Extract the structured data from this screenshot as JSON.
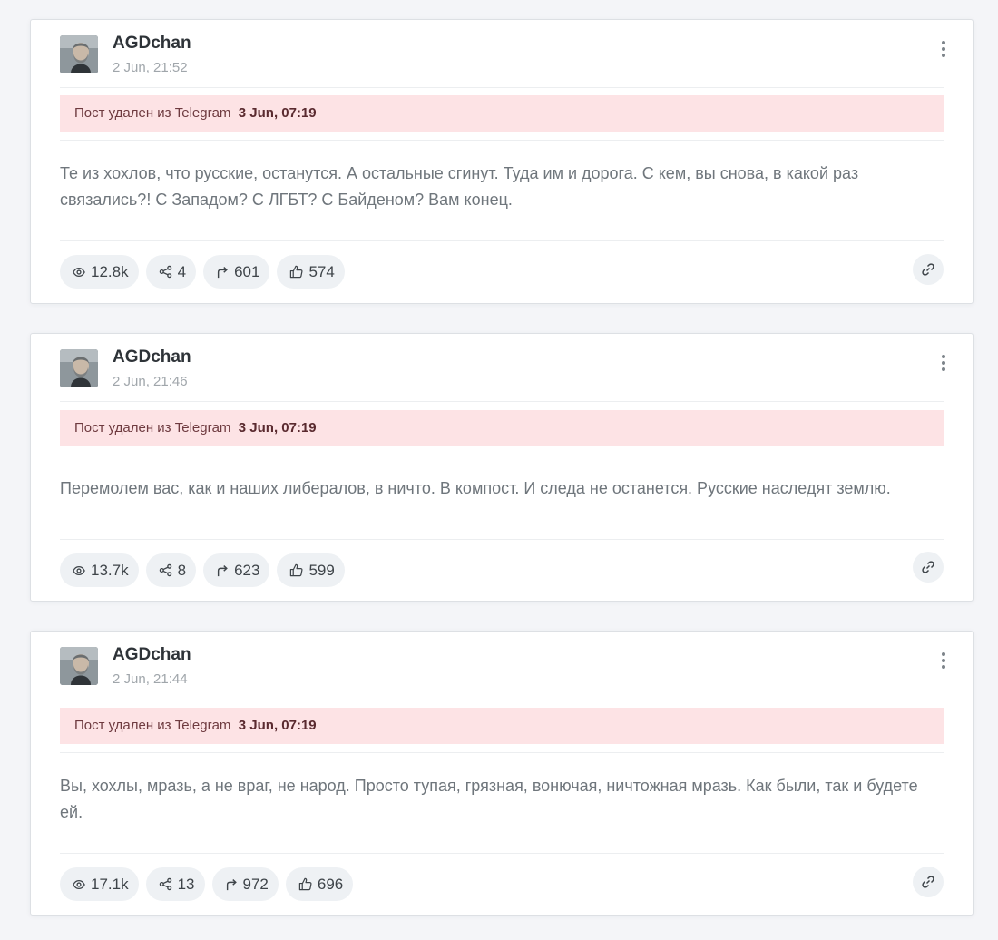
{
  "posts": [
    {
      "author": "AGDchan",
      "date": "2 Jun, 21:52",
      "deleted_label": "Пост удален из Telegram",
      "deleted_date": "3 Jun, 07:19",
      "text": "Те из хохлов, что русские, останутся. А остальные сгинут. Туда им и дорога. С кем, вы снова, в какой раз связались?! С Западом? С ЛГБТ? С Байденом? Вам конец.",
      "views": "12.8k",
      "shares": "4",
      "forwards": "601",
      "likes": "574"
    },
    {
      "author": "AGDchan",
      "date": "2 Jun, 21:46",
      "deleted_label": "Пост удален из Telegram",
      "deleted_date": "3 Jun, 07:19",
      "text": "Перемолем вас, как и наших либералов, в ничто. В компост. И следа не останется. Русские наследят землю.",
      "views": "13.7k",
      "shares": "8",
      "forwards": "623",
      "likes": "599"
    },
    {
      "author": "AGDchan",
      "date": "2 Jun, 21:44",
      "deleted_label": "Пост удален из Telegram",
      "deleted_date": "3 Jun, 07:19",
      "text": "Вы, хохлы, мразь, а не враг, не народ. Просто тупая, грязная, вонючая, ничтожная мразь. Как были, так и будете ей.",
      "views": "17.1k",
      "shares": "13",
      "forwards": "972",
      "likes": "696"
    }
  ],
  "icons": {
    "views": "eye-icon",
    "shares": "share-icon",
    "forwards": "forward-icon",
    "likes": "thumbs-up-icon",
    "menu": "more-vertical-icon",
    "link": "link-icon"
  },
  "colors": {
    "deleted_bg": "#fde3e5",
    "pill_bg": "#eef1f4",
    "page_bg": "#f4f5f8"
  }
}
